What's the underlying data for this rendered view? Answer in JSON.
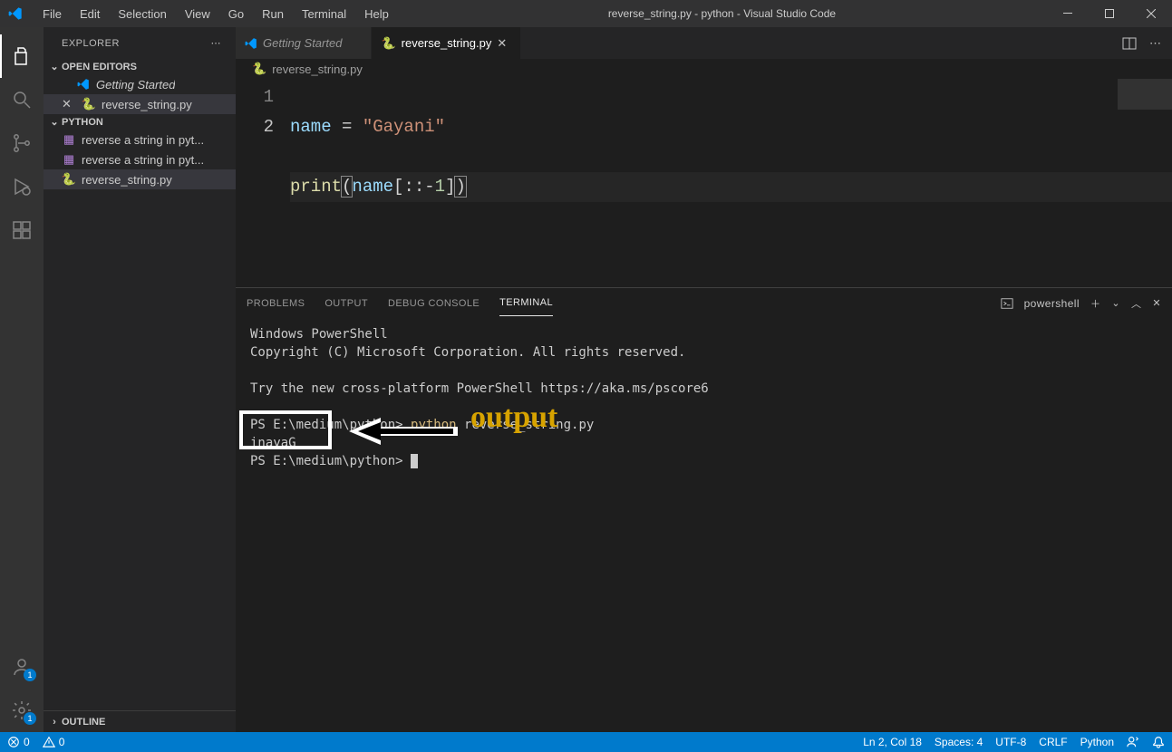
{
  "title": "reverse_string.py - python - Visual Studio Code",
  "menu": [
    "File",
    "Edit",
    "Selection",
    "View",
    "Go",
    "Run",
    "Terminal",
    "Help"
  ],
  "explorer": {
    "title": "EXPLORER",
    "openEditors": {
      "title": "OPEN EDITORS",
      "items": [
        {
          "name": "Getting Started",
          "icon": "vscode",
          "italic": true,
          "closable": false
        },
        {
          "name": "reverse_string.py",
          "icon": "python",
          "closable": true,
          "active": true
        }
      ]
    },
    "workspace": {
      "title": "PYTHON",
      "items": [
        {
          "name": "reverse a string in pyt...",
          "icon": "notebook"
        },
        {
          "name": "reverse a string in pyt...",
          "icon": "notebook"
        },
        {
          "name": "reverse_string.py",
          "icon": "python",
          "active": true
        }
      ]
    },
    "outline": "OUTLINE"
  },
  "tabs": [
    {
      "name": "Getting Started",
      "icon": "vscode",
      "italic": true
    },
    {
      "name": "reverse_string.py",
      "icon": "python",
      "active": true
    }
  ],
  "breadcrumb": {
    "icon": "python",
    "name": "reverse_string.py"
  },
  "code": {
    "lines": [
      "1",
      "2"
    ],
    "line1": {
      "name": "name",
      "op": " = ",
      "str": "\"Gayani\""
    },
    "line2": {
      "fn": "print",
      "open": "(",
      "name": "name",
      "lb": "[",
      "c1": ":",
      "c2": ":",
      "neg": "-",
      "num": "1",
      "rb": "]",
      "close": ")"
    }
  },
  "panel": {
    "tabs": [
      "PROBLEMS",
      "OUTPUT",
      "DEBUG CONSOLE",
      "TERMINAL"
    ],
    "active": 3,
    "shell": "powershell"
  },
  "terminal": {
    "line1": "Windows PowerShell",
    "line2": "Copyright (C) Microsoft Corporation. All rights reserved.",
    "line3_a": "Try the new cross-platform PowerShell ",
    "line3_b": "https://aka.ms/pscore6",
    "prompt1_a": "PS E:\\medium\\python> ",
    "prompt1_cmd": "python",
    "prompt1_b": " reverse_string.py",
    "output": "inayaG",
    "prompt2": "PS E:\\medium\\python> ",
    "annotation": "output"
  },
  "status": {
    "errors": "0",
    "warnings": "0",
    "pos": "Ln 2, Col 18",
    "spaces": "Spaces: 4",
    "enc": "UTF-8",
    "eol": "CRLF",
    "lang": "Python"
  },
  "badges": {
    "accounts": "1",
    "settings": "1"
  }
}
